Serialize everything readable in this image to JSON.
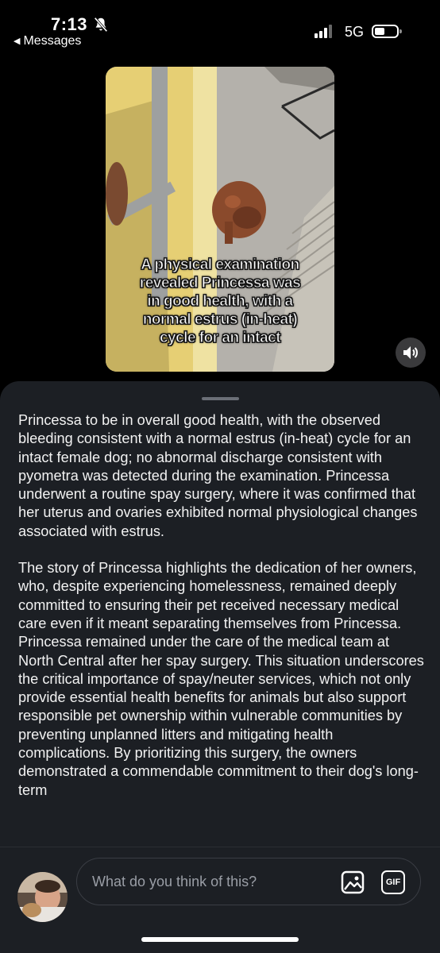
{
  "status_bar": {
    "time": "7:13",
    "back_label": "Messages",
    "network": "5G",
    "icons": [
      "bell-slash-icon",
      "signal-icon",
      "battery-icon"
    ]
  },
  "video": {
    "caption_lines": [
      "A physical examination",
      "revealed Princessa was",
      "in good health, with a",
      "normal estrus (in-heat)",
      "cycle for an intact"
    ],
    "sound_icon": "speaker-icon"
  },
  "article": {
    "paragraphs": [
      "Princessa to be in overall good health, with the observed bleeding consistent with a normal estrus (in-heat) cycle for an intact female dog; no abnormal discharge consistent with pyometra was detected during the examination. Princessa underwent a routine spay surgery, where it was confirmed that her uterus and ovaries exhibited normal physiological changes associated with estrus.",
      "The story of Princessa highlights the dedication of her owners, who, despite experiencing homelessness, remained deeply committed to ensuring their pet received necessary medical care even if it meant separating themselves from Princessa. Princessa remained under the care of the medical team at North Central after her spay surgery. This situation underscores the critical importance of spay/neuter services, which not only provide essential health benefits for animals but also support responsible pet ownership within vulnerable communities by preventing unplanned litters and mitigating health complications. By prioritizing this surgery, the owners demonstrated a commendable commitment to their dog's long-term"
    ]
  },
  "composer": {
    "placeholder": "What do you think of this?",
    "gif_label": "GIF",
    "image_icon": "image-icon"
  },
  "colors": {
    "background": "#000000",
    "sheet": "#1c1f24",
    "placeholder": "#9a9ea6"
  }
}
